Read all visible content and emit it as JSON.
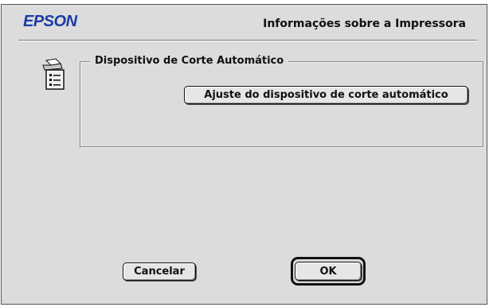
{
  "window": {
    "brand": "EPSON",
    "title": "Informações sobre a Impressora"
  },
  "info_icon": {
    "icon": "printer-info-icon"
  },
  "auto_cutter_group": {
    "legend": "Dispositivo de Corte Automático",
    "adjust_button": "Ajuste do dispositivo de corte automático"
  },
  "footer": {
    "cancel_button": "Cancelar",
    "ok_button": "OK"
  },
  "colors": {
    "brand": "#1a3ba5",
    "window_background": "#dcdcdc"
  }
}
